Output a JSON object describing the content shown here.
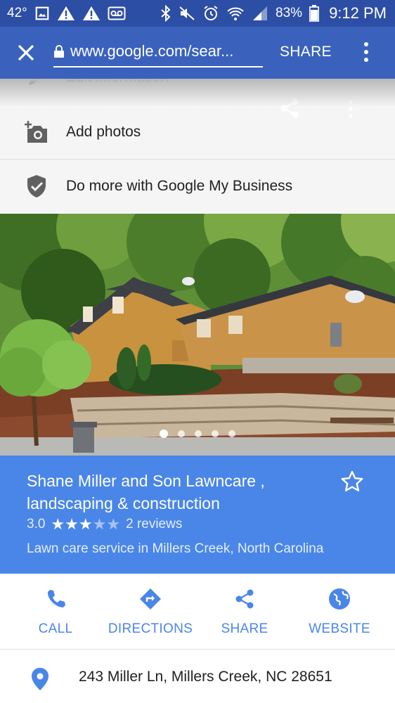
{
  "status_bar": {
    "temperature": "42°",
    "battery_percent": "83%",
    "time": "9:12 PM",
    "icons": [
      "image-icon",
      "warning-icon",
      "warning-icon",
      "voicemail-icon",
      "bluetooth-icon",
      "mute-icon",
      "alarm-icon",
      "wifi-icon",
      "signal-icon",
      "battery-icon"
    ]
  },
  "toolbar": {
    "url": "www.google.com/sear...",
    "share_label": "SHARE",
    "close_icon": "close-icon",
    "more_icon": "more-vert-icon"
  },
  "menu": {
    "items": [
      {
        "label": "Edit information",
        "icon": "pencil-icon"
      },
      {
        "label": "Add photos",
        "icon": "add-photo-icon"
      },
      {
        "label": "Do more with Google My Business",
        "icon": "verified-shield-icon"
      }
    ]
  },
  "photo": {
    "page_count": 5,
    "active_index": 0
  },
  "business": {
    "name": "Shane Miller and Son Lawncare , landscaping & construction",
    "rating": "3.0",
    "rating_value": 3,
    "rating_max": 5,
    "reviews": "2 reviews",
    "category": "Lawn care service in Millers Creek, North Carolina"
  },
  "actions": [
    {
      "label": "CALL",
      "icon": "phone-icon"
    },
    {
      "label": "DIRECTIONS",
      "icon": "directions-icon"
    },
    {
      "label": "SHARE",
      "icon": "share-icon"
    },
    {
      "label": "WEBSITE",
      "icon": "globe-icon"
    }
  ],
  "address": "243 Miller Ln, Millers Creek, NC 28651",
  "colors": {
    "status_bar": "#2d4ea5",
    "toolbar": "#3a62bd",
    "card": "#4a86e8",
    "accent": "#4a86e8"
  }
}
